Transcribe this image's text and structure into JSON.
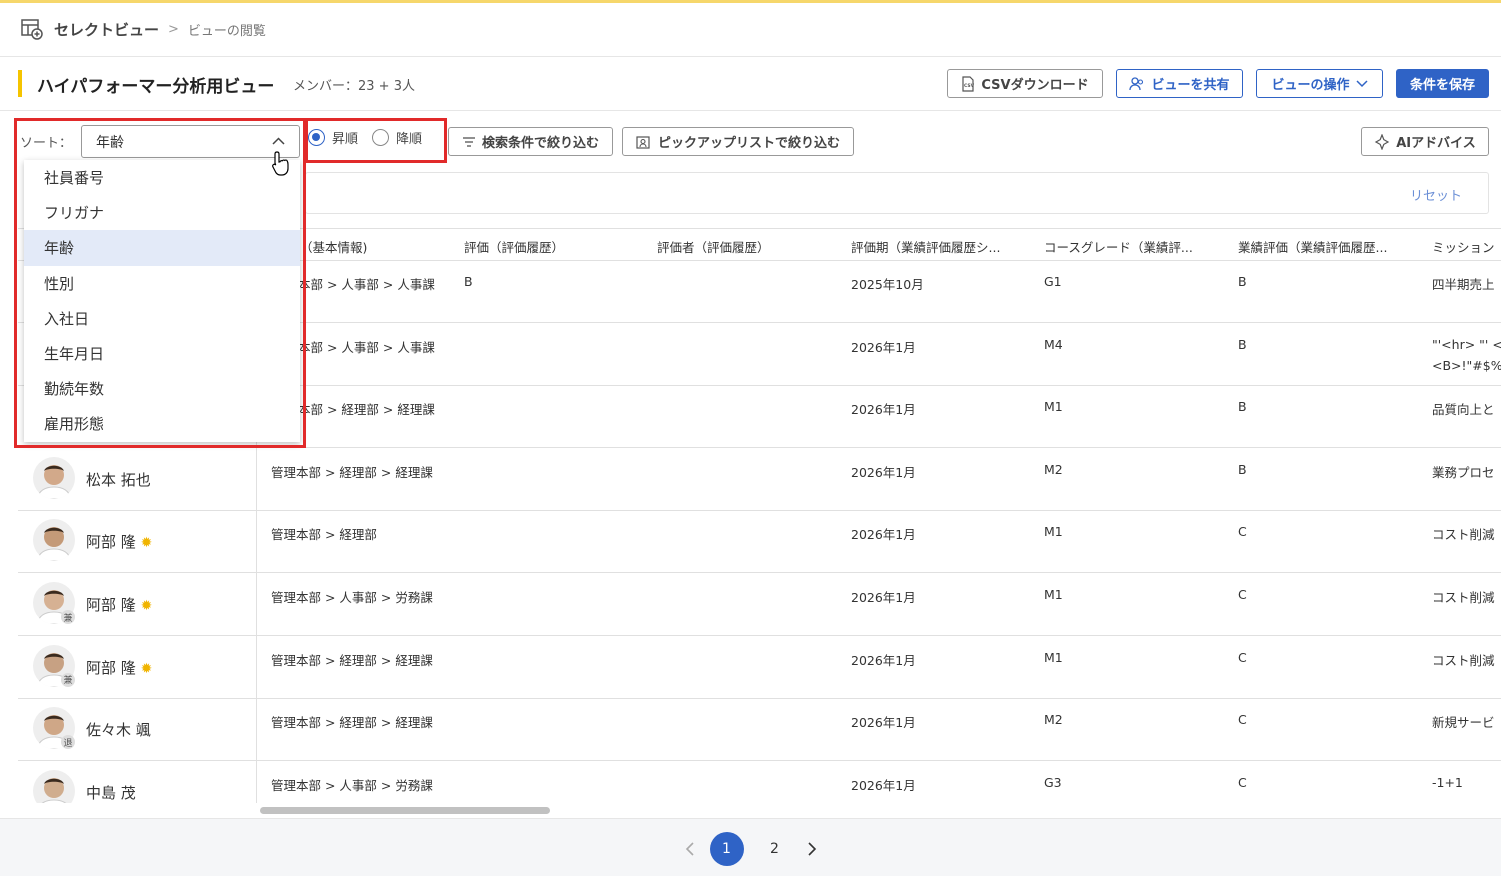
{
  "breadcrumb": {
    "main": "セレクトビュー",
    "sub": "ビューの閲覧"
  },
  "header": {
    "title": "ハイパフォーマー分析用ビュー",
    "members": "メンバー：23 + 3人"
  },
  "actions": {
    "csv": "CSVダウンロード",
    "share": "ビューを共有",
    "operate": "ビューの操作",
    "save": "条件を保存"
  },
  "toolbar": {
    "sort_label": "ソート：",
    "sort_value": "年齢",
    "asc": "昇順",
    "desc": "降順",
    "filter_search": "検索条件で絞り込む",
    "filter_pickup": "ピックアップリストで絞り込む",
    "ai": "AIアドバイス",
    "reset": "リセット"
  },
  "sort_options": [
    "社員番号",
    "フリガナ",
    "年齢",
    "性別",
    "入社日",
    "生年月日",
    "勤続年数",
    "雇用形態"
  ],
  "table": {
    "headers": [
      "（基本情報)",
      "評価（評価履歴）",
      "評価者（評価履歴）",
      "評価期（業績評価履歴シ...",
      "コースグレード（業績評...",
      "業績評価（業績評価履歴...",
      "ミッション"
    ],
    "rows": [
      {
        "name": "",
        "badge": "",
        "dept": "本部 > 人事部 > 人事課",
        "rating": "B",
        "period": "2025年10月",
        "grade": "G1",
        "perf": "B",
        "mission": "四半期売上",
        "mission2": ""
      },
      {
        "name": "",
        "badge": "",
        "dept": "本部 > 人事部 > 人事課",
        "rating": "",
        "period": "2026年1月",
        "grade": "M4",
        "perf": "B",
        "mission": "\"'<hr> \"' <",
        "mission2": "<B>!\"#$%&"
      },
      {
        "name": "",
        "badge": "",
        "dept": "本部 > 経理部 > 経理課",
        "rating": "",
        "period": "2026年1月",
        "grade": "M1",
        "perf": "B",
        "mission": "品質向上と",
        "mission2": ""
      },
      {
        "name": "松本 拓也",
        "badge": "",
        "dept": "管理本部 > 経理部 > 経理課",
        "rating": "",
        "period": "2026年1月",
        "grade": "M2",
        "perf": "B",
        "mission": "業務プロセ",
        "mission2": ""
      },
      {
        "name": "阿部 隆",
        "badge": "",
        "dept": "管理本部 > 経理部",
        "rating": "",
        "period": "2026年1月",
        "grade": "M1",
        "perf": "C",
        "mission": "コスト削減",
        "mission2": ""
      },
      {
        "name": "阿部 隆",
        "badge": "兼",
        "dept": "管理本部 > 人事部 > 労務課",
        "rating": "",
        "period": "2026年1月",
        "grade": "M1",
        "perf": "C",
        "mission": "コスト削減",
        "mission2": ""
      },
      {
        "name": "阿部 隆",
        "badge": "兼",
        "dept": "管理本部 > 経理部 > 経理課",
        "rating": "",
        "period": "2026年1月",
        "grade": "M1",
        "perf": "C",
        "mission": "コスト削減",
        "mission2": ""
      },
      {
        "name": "佐々木 颯",
        "badge": "退",
        "dept": "管理本部 > 経理部 > 経理課",
        "rating": "",
        "period": "2026年1月",
        "grade": "M2",
        "perf": "C",
        "mission": "新規サービ",
        "mission2": ""
      },
      {
        "name": "中島 茂",
        "badge": "",
        "dept": "管理本部 > 人事部 > 労務課",
        "rating": "",
        "period": "2026年1月",
        "grade": "G3",
        "perf": "C",
        "mission": "-1+1",
        "mission2": ""
      }
    ]
  },
  "pagination": {
    "pages": [
      "1",
      "2"
    ],
    "current": "1"
  },
  "colors": {
    "accent": "#2f63c6",
    "highlight": "#e12a2a",
    "title_bar": "#f5c400"
  }
}
